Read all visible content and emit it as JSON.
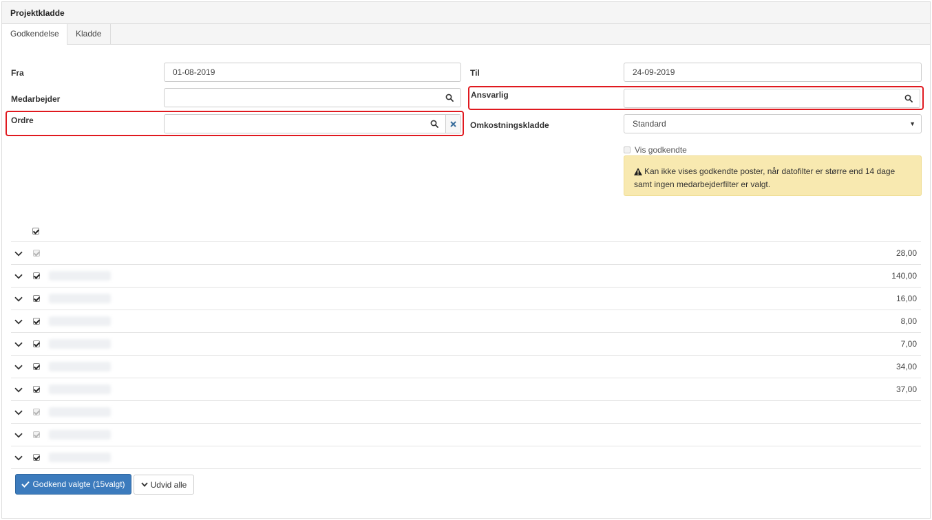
{
  "panel": {
    "title": "Projektkladde"
  },
  "tabs": [
    {
      "label": "Godkendelse"
    },
    {
      "label": "Kladde"
    }
  ],
  "filters": {
    "fra_label": "Fra",
    "fra_value": "01-08-2019",
    "til_label": "Til",
    "til_value": "24-09-2019",
    "medarbejder_label": "Medarbejder",
    "medarbejder_value": "",
    "ansvarlig_label": "Ansvarlig",
    "ansvarlig_value": "",
    "ordre_label": "Ordre",
    "ordre_value": "",
    "omkostningskladde_label": "Omkostningskladde",
    "omkostningskladde_value": "Standard",
    "vis_godkendte_label": "Vis godkendte"
  },
  "alert": {
    "text": "Kan ikke vises godkendte poster, når datofilter er større end 14 dage samt ingen medarbejderfilter er valgt."
  },
  "rows": [
    {
      "name": "",
      "amount": "28,00",
      "checked": true,
      "disabled": true
    },
    {
      "name": "redacted@user.dk",
      "amount": "140,00",
      "checked": true,
      "disabled": false
    },
    {
      "name": "redacted",
      "amount": "16,00",
      "checked": true,
      "disabled": false
    },
    {
      "name": "redacted",
      "amount": "8,00",
      "checked": true,
      "disabled": false
    },
    {
      "name": "redacted name",
      "amount": "7,00",
      "checked": true,
      "disabled": false
    },
    {
      "name": "redacted",
      "amount": "34,00",
      "checked": true,
      "disabled": false
    },
    {
      "name": "redacted",
      "amount": "37,00",
      "checked": true,
      "disabled": false
    },
    {
      "name": "redacted",
      "amount": "",
      "checked": true,
      "disabled": true
    },
    {
      "name": "redacted",
      "amount": "",
      "checked": true,
      "disabled": true
    },
    {
      "name": "redacted",
      "amount": "",
      "checked": true,
      "disabled": false
    }
  ],
  "buttons": {
    "approve_label": "Godkend valgte (15valgt)",
    "expand_label": "Udvid alle"
  },
  "colors": {
    "primary": "#3c7bbd",
    "highlight": "#e0191f",
    "alert_bg": "#f8e9b0"
  },
  "icons": {
    "search": "search-icon",
    "clear": "close-icon",
    "chevron": "chevron-down-icon",
    "warning": "warning-icon",
    "check": "check-icon"
  }
}
